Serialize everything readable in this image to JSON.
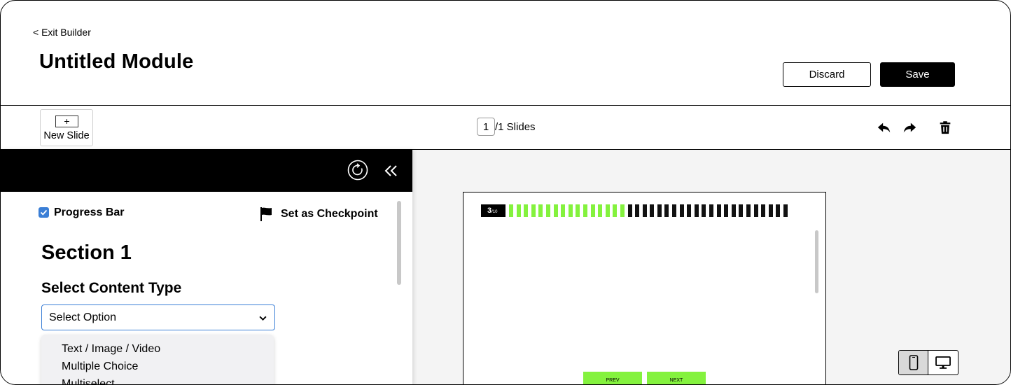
{
  "header": {
    "exit_label": "< Exit Builder",
    "title": "Untitled Module",
    "discard_label": "Discard",
    "save_label": "Save"
  },
  "toolbar": {
    "new_slide_plus": "+",
    "new_slide_label": "New Slide",
    "current_slide": "1",
    "slides_suffix": "/1 Slides",
    "icons": [
      "undo-icon",
      "redo-icon",
      "trash-icon"
    ]
  },
  "panel": {
    "progress_bar_label": "Progress Bar",
    "progress_bar_checked": true,
    "checkpoint_label": "Set as Checkpoint",
    "section_title": "Section 1",
    "content_type_label": "Select Content Type",
    "select_value": "Select Option",
    "options": [
      "Text / Image / Video",
      "Multiple Choice",
      "Multiselect"
    ],
    "icons": [
      "refresh-icon",
      "collapse-left-icon",
      "flag-icon",
      "chevron-down-icon"
    ]
  },
  "preview": {
    "progress_current": "3",
    "progress_suffix": "/10",
    "segments_done": 16,
    "segments_total": 38,
    "prev_label": "PREV",
    "next_label": "NEXT",
    "accent_color": "#84f23e",
    "device_options": [
      "mobile-icon",
      "desktop-icon"
    ],
    "device_selected": "mobile"
  }
}
